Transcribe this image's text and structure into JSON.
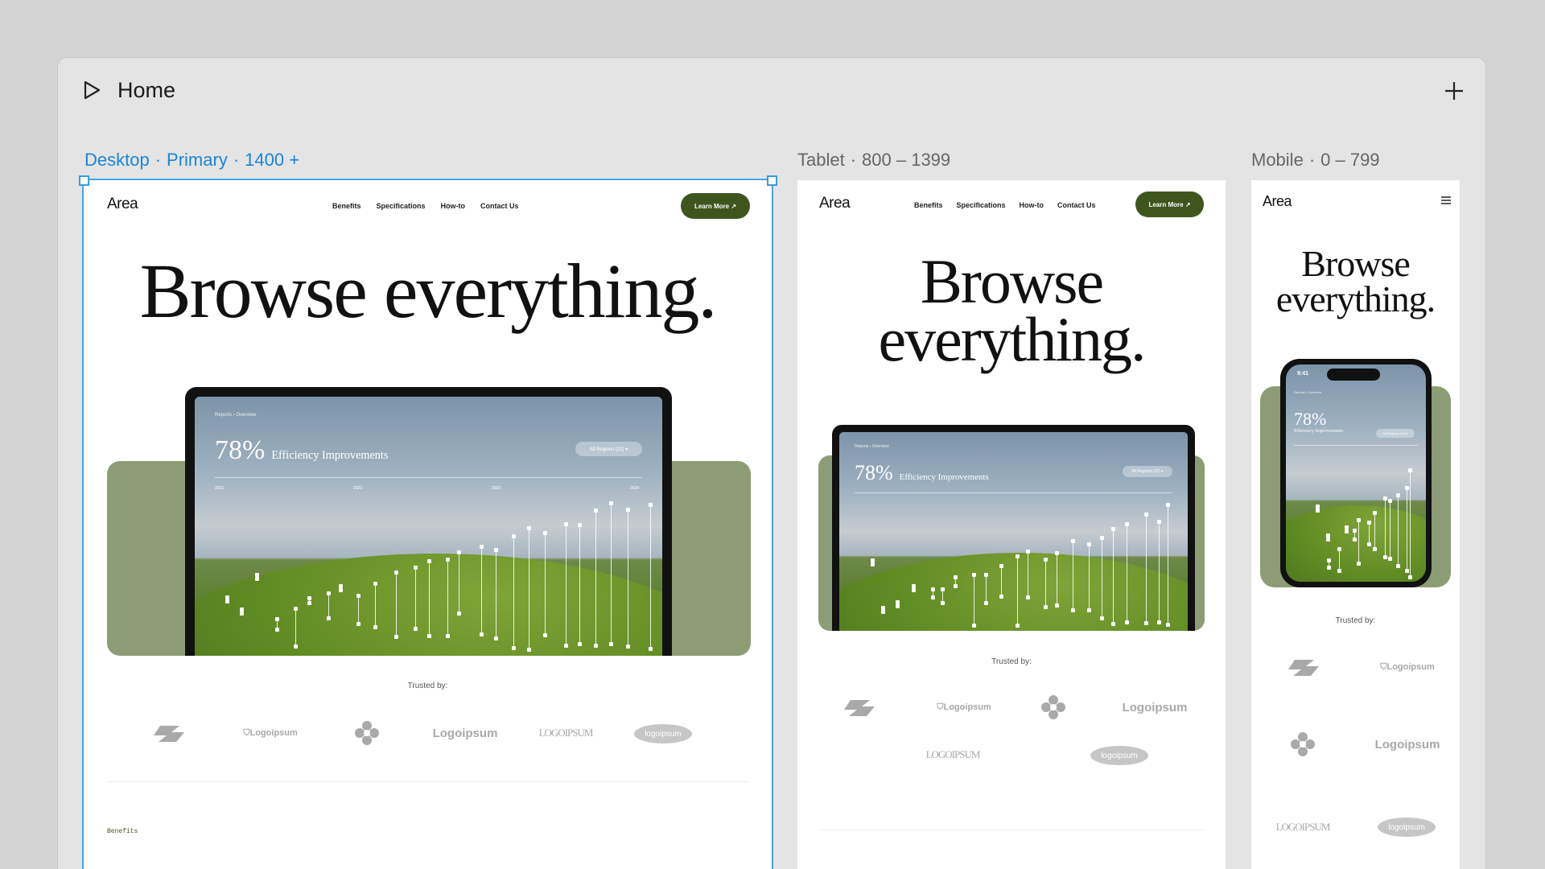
{
  "panel": {
    "title": "Home"
  },
  "breakpoints": {
    "desktop": {
      "name": "Desktop",
      "tag": "Primary",
      "range": "1400 +"
    },
    "tablet": {
      "name": "Tablet",
      "range": "800 – 1399"
    },
    "mobile": {
      "name": "Mobile",
      "range": "0 – 799"
    }
  },
  "site": {
    "logo": "Area",
    "nav": [
      "Benefits",
      "Specifications",
      "How-to",
      "Contact Us"
    ],
    "cta": "Learn More ↗",
    "headline": "Browse everything.",
    "headline_line1": "Browse",
    "headline_line2": "everything.",
    "breadcrumb": "Reports  ›  Overview",
    "stat_value": "78%",
    "stat_label": "Efficiency Improvements",
    "region_pill": "All Regions (22)  ▾",
    "years": [
      "2021",
      "2022",
      "2023",
      "2024"
    ],
    "phone_time": "9:41",
    "trusted": "Trusted by:",
    "logos": [
      "Logoipsum",
      "Logoipsum",
      "LOGOIPSUM",
      "logoipsum"
    ],
    "section_tag": "Benefits"
  },
  "colors": {
    "accent": "#3e561e",
    "sage": "#8c9c74",
    "selection": "#1a84d8"
  },
  "icons": {
    "play": "play-icon",
    "plus": "plus-icon",
    "menu": "menu-icon",
    "shield": "shield-icon",
    "flower": "flower-icon",
    "arrows": "arrows-logo-icon"
  }
}
